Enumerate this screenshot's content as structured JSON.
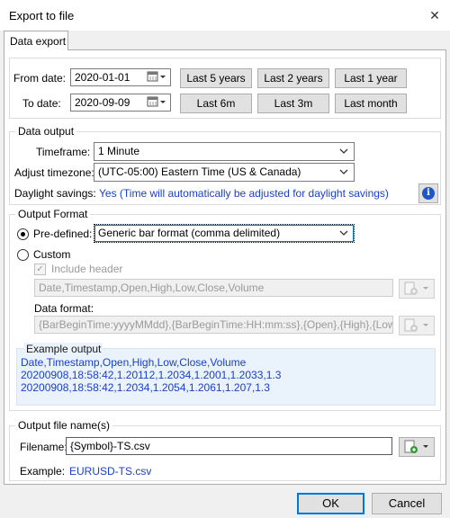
{
  "window": {
    "title": "Export to file",
    "close_glyph": "✕"
  },
  "tabs": [
    {
      "label": "Data export"
    }
  ],
  "dates": {
    "from_label": "From date:",
    "from_value": "2020-01-01",
    "to_label": "To date:",
    "to_value": "2020-09-09",
    "presets": [
      "Last 5 years",
      "Last 2 years",
      "Last 1 year",
      "Last 6m",
      "Last 3m",
      "Last month"
    ]
  },
  "data_output": {
    "group_label": "Data output",
    "timeframe_label": "Timeframe:",
    "timeframe_value": "1 Minute",
    "timezone_label": "Adjust timezone:",
    "timezone_value": "(UTC-05:00) Eastern Time (US & Canada)",
    "dst_label": "Daylight savings:",
    "dst_value": "Yes (Time will automatically be adjusted for daylight savings)",
    "info_glyph": "i"
  },
  "output_format": {
    "group_label": "Output Format",
    "predefined_label": "Pre-defined:",
    "predefined_value": "Generic bar format (comma delimited)",
    "custom_label": "Custom",
    "include_header_label": "Include header",
    "header_value": "Date,Timestamp,Open,High,Low,Close,Volume",
    "data_format_label": "Data format:",
    "data_format_value": "{BarBeginTime:yyyyMMdd},{BarBeginTime:HH:mm:ss},{Open},{High},{Low},{C",
    "example_label": "Example output",
    "example_lines": [
      "Date,Timestamp,Open,High,Low,Close,Volume",
      "20200908,18:58:42,1.20112,1.2034,1.2001,1.2033,1.3",
      "20200908,18:58:42,1.2034,1.2054,1.2061,1.207,1.3"
    ]
  },
  "output_file": {
    "group_label": "Output file name(s)",
    "filename_label": "Filename:",
    "filename_value": "{Symbol}-TS.csv",
    "example_label": "Example:",
    "example_value": "EURUSD-TS.csv"
  },
  "footer": {
    "ok_label": "OK",
    "cancel_label": "Cancel"
  },
  "colors": {
    "link_blue": "#1a3fcc",
    "info_blue": "#1e56c8",
    "focus_blue": "#0078d7",
    "example_bg": "#eaf2fb"
  },
  "icons": [
    "close-icon",
    "calendar-icon",
    "chevron-down-icon",
    "info-icon",
    "add-token-icon"
  ]
}
